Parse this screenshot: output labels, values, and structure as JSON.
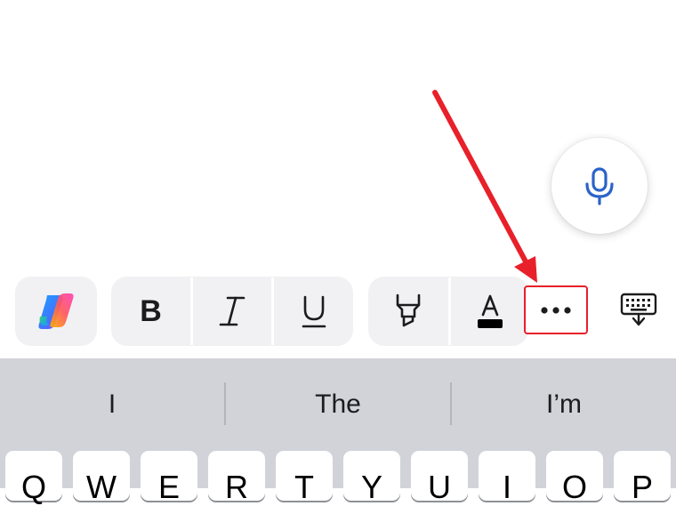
{
  "colors": {
    "accent_blue": "#2b63c9",
    "highlight_red": "#e8202a",
    "toolbar_bg": "#f1f1f3",
    "keyboard_bg": "#d1d3d9"
  },
  "mic_button": {
    "icon": "microphone-icon"
  },
  "toolbar": {
    "copilot_icon": "copilot-icon",
    "bold_label": "B",
    "italic_icon": "italic-icon",
    "underline_icon": "underline-icon",
    "highlight_icon": "highlighter-icon",
    "font_color_icon": "font-color-icon",
    "font_color_letter": "A",
    "more_icon": "ellipsis-icon",
    "dismiss_keyboard_icon": "keyboard-dismiss-icon"
  },
  "keyboard": {
    "suggestions": [
      "I",
      "The",
      "I’m"
    ],
    "top_row_keys": [
      "Q",
      "W",
      "E",
      "R",
      "T",
      "Y",
      "U",
      "I",
      "O",
      "P"
    ]
  }
}
